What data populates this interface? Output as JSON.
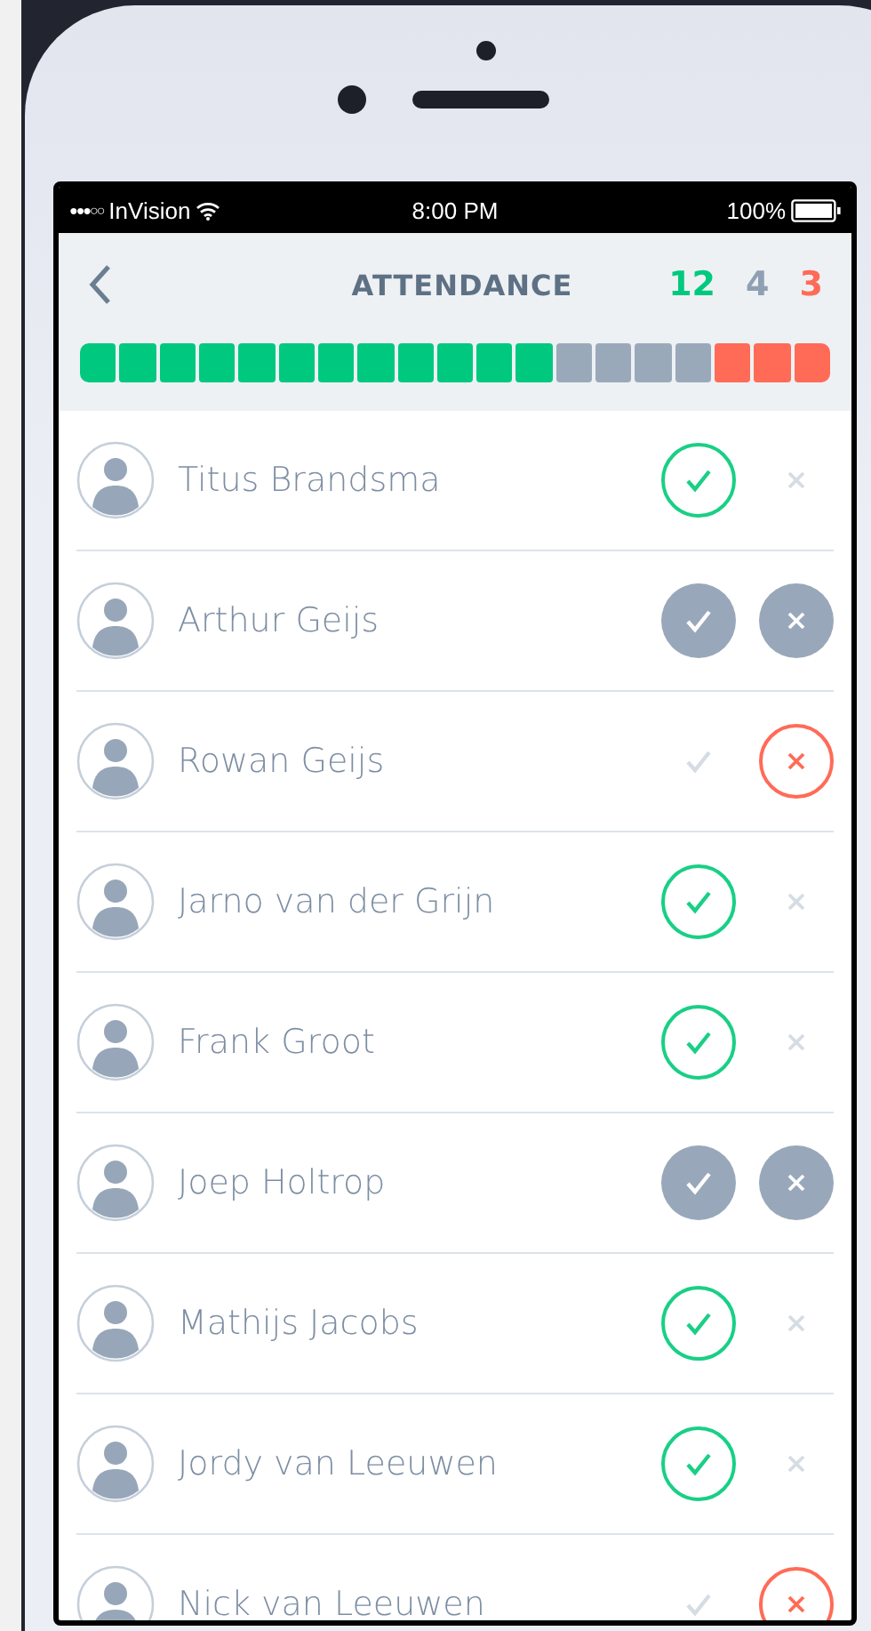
{
  "status_bar": {
    "signal_bars": "●●●○○",
    "carrier": "InVision",
    "time": "8:00 PM",
    "battery": "100%"
  },
  "header": {
    "title": "ATTENDANCE",
    "counts": [
      {
        "value": "12",
        "color": "#00c97f"
      },
      {
        "value": "4",
        "color": "#8fa0b3"
      },
      {
        "value": "3",
        "color": "#ff6b57"
      }
    ]
  },
  "progress_segments": [
    {
      "color": "#00c97f"
    },
    {
      "color": "#00c97f"
    },
    {
      "color": "#00c97f"
    },
    {
      "color": "#00c97f"
    },
    {
      "color": "#00c97f"
    },
    {
      "color": "#00c97f"
    },
    {
      "color": "#00c97f"
    },
    {
      "color": "#00c97f"
    },
    {
      "color": "#00c97f"
    },
    {
      "color": "#00c97f"
    },
    {
      "color": "#00c97f"
    },
    {
      "color": "#00c97f"
    },
    {
      "color": "#9aa9ba"
    },
    {
      "color": "#9aa9ba"
    },
    {
      "color": "#9aa9ba"
    },
    {
      "color": "#9aa9ba"
    },
    {
      "color": "#ff6b57"
    },
    {
      "color": "#ff6b57"
    },
    {
      "color": "#ff6b57"
    }
  ],
  "people": [
    {
      "name": "Titus Brandsma",
      "present": true,
      "absent": false
    },
    {
      "name": "Arthur Geijs",
      "present": false,
      "absent": false
    },
    {
      "name": "Rowan Geijs",
      "present": false,
      "absent": true
    },
    {
      "name": "Jarno van der Grijn",
      "present": true,
      "absent": false
    },
    {
      "name": "Frank Groot",
      "present": true,
      "absent": false
    },
    {
      "name": "Joep Holtrop",
      "present": false,
      "absent": false
    },
    {
      "name": "Mathijs Jacobs",
      "present": true,
      "absent": false
    },
    {
      "name": "Jordy van Leeuwen",
      "present": true,
      "absent": false
    },
    {
      "name": "Nick van Leeuwen",
      "present": false,
      "absent": true
    }
  ]
}
